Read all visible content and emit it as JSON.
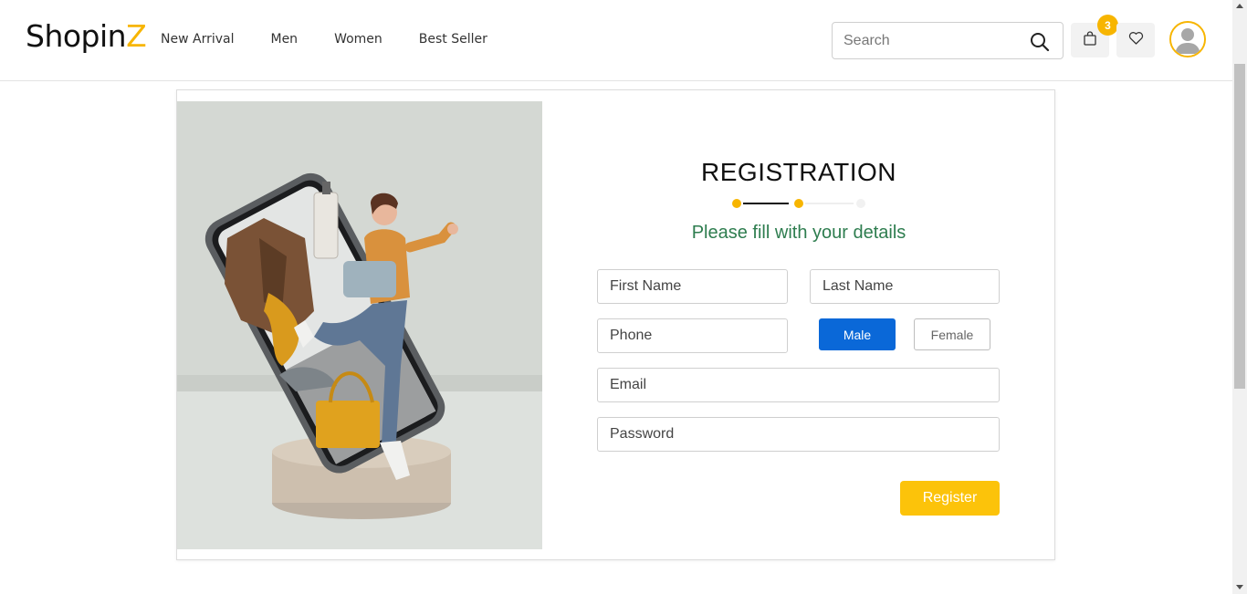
{
  "brand": {
    "name_main": "Shopin",
    "name_accent": "Z",
    "accent_color": "#f7b500"
  },
  "nav": {
    "items": [
      "New Arrival",
      "Men",
      "Women",
      "Best Seller"
    ]
  },
  "search": {
    "placeholder": "Search",
    "icon": "search-icon"
  },
  "header_actions": {
    "cart_count": "3",
    "cart_icon": "shopping-bag-icon",
    "wishlist_icon": "heart-icon",
    "avatar_icon": "user-avatar-icon"
  },
  "registration": {
    "title": "REGISTRATION",
    "subtitle": "Please fill with your details",
    "subtitle_color": "#2e7d4f",
    "fields": {
      "first_name": {
        "placeholder": "First Name",
        "value": ""
      },
      "last_name": {
        "placeholder": "Last Name",
        "value": ""
      },
      "phone": {
        "placeholder": "Phone",
        "value": ""
      },
      "email": {
        "placeholder": "Email",
        "value": ""
      },
      "password": {
        "placeholder": "Password",
        "value": ""
      }
    },
    "gender": {
      "options": [
        "Male",
        "Female"
      ],
      "selected": "Male",
      "selected_color": "#0a68d8"
    },
    "register_label": "Register",
    "register_color": "#fcc30a"
  },
  "hero_image": {
    "subject": "woman-jumping-out-of-phone-illustration"
  }
}
